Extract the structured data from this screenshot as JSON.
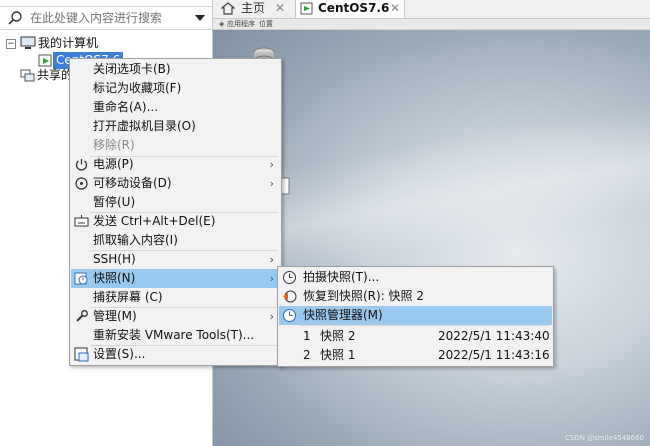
{
  "search": {
    "placeholder": "在此处键入内容进行搜索"
  },
  "library": {
    "my_computer": "我的计算机",
    "vm_name": "CentOS7.6",
    "shared": "共享的"
  },
  "tabs": [
    {
      "label": "主页"
    },
    {
      "label": "CentOS7.6"
    }
  ],
  "gnome_topbar": {
    "apps": "应用程序",
    "places": "位置"
  },
  "desktop": {
    "watermark": "CSDN @smile4548660"
  },
  "context_menu": {
    "items": [
      {
        "label": "关闭选项卡(B)"
      },
      {
        "label": "标记为收藏项(F)"
      },
      {
        "label": "重命名(A)..."
      },
      {
        "label": "打开虚拟机目录(O)"
      },
      {
        "label": "移除(R)"
      },
      {
        "label": "电源(P)"
      },
      {
        "label": "可移动设备(D)"
      },
      {
        "label": "暂停(U)"
      },
      {
        "label": "发送 Ctrl+Alt+Del(E)"
      },
      {
        "label": "抓取输入内容(I)"
      },
      {
        "label": "SSH(H)"
      },
      {
        "label": "快照(N)"
      },
      {
        "label": "捕获屏幕 (C)"
      },
      {
        "label": "管理(M)"
      },
      {
        "label": "重新安装 VMware Tools(T)..."
      },
      {
        "label": "设置(S)..."
      }
    ]
  },
  "snapshot_menu": {
    "take": "拍摄快照(T)...",
    "revert": "恢复到快照(R): 快照 2",
    "manager": "快照管理器(M)",
    "snapshots": [
      {
        "num": "1",
        "name": "快照 2",
        "date": "2022/5/1 11:43:40"
      },
      {
        "num": "2",
        "name": "快照 1",
        "date": "2022/5/1 11:43:16"
      }
    ]
  },
  "colors": {
    "highlight": "#99c9ef",
    "selected_vm": "#3c7fd8"
  }
}
